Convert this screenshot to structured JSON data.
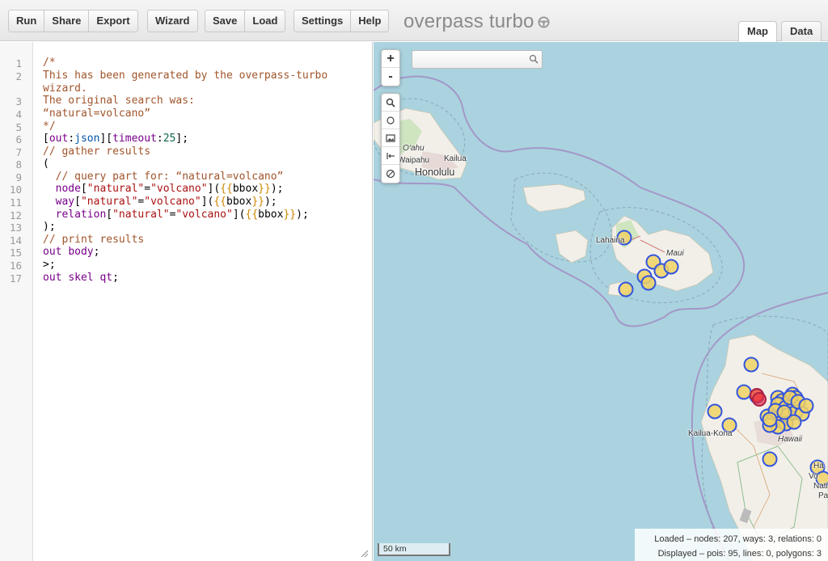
{
  "toolbar": {
    "run": "Run",
    "share": "Share",
    "export": "Export",
    "wizard": "Wizard",
    "save": "Save",
    "load": "Load",
    "settings": "Settings",
    "help": "Help",
    "logo": "overpass turbo"
  },
  "tabs": {
    "map": "Map",
    "data": "Data"
  },
  "editor": {
    "line_numbers": [
      "1",
      "2",
      "",
      "3",
      "4",
      "5",
      "6",
      "7",
      "8",
      "9",
      "10",
      "11",
      "12",
      "13",
      "14",
      "15",
      "16",
      "17"
    ],
    "lines": [
      {
        "parts": [
          {
            "cls": "c",
            "text": "/*"
          }
        ]
      },
      {
        "parts": [
          {
            "cls": "c",
            "text": "This has been generated by the overpass-turbo"
          }
        ]
      },
      {
        "parts": [
          {
            "cls": "c",
            "text": "wizard."
          }
        ]
      },
      {
        "parts": [
          {
            "cls": "c",
            "text": "The original search was:"
          }
        ]
      },
      {
        "parts": [
          {
            "cls": "c",
            "text": "“natural=volcano”"
          }
        ]
      },
      {
        "parts": [
          {
            "cls": "c",
            "text": "*/"
          }
        ]
      },
      {
        "parts": [
          {
            "cls": "",
            "text": "["
          },
          {
            "cls": "k",
            "text": "out"
          },
          {
            "cls": "",
            "text": ":"
          },
          {
            "cls": "t",
            "text": "json"
          },
          {
            "cls": "",
            "text": "]["
          },
          {
            "cls": "k",
            "text": "timeout"
          },
          {
            "cls": "",
            "text": ":"
          },
          {
            "cls": "n",
            "text": "25"
          },
          {
            "cls": "",
            "text": "];"
          }
        ]
      },
      {
        "parts": [
          {
            "cls": "c",
            "text": "// gather results"
          }
        ]
      },
      {
        "parts": [
          {
            "cls": "",
            "text": "("
          }
        ]
      },
      {
        "parts": [
          {
            "cls": "",
            "text": "  "
          },
          {
            "cls": "c",
            "text": "// query part for: “natural=volcano”"
          }
        ]
      },
      {
        "parts": [
          {
            "cls": "",
            "text": "  "
          },
          {
            "cls": "k",
            "text": "node"
          },
          {
            "cls": "",
            "text": "["
          },
          {
            "cls": "s",
            "text": "\"natural\""
          },
          {
            "cls": "",
            "text": "="
          },
          {
            "cls": "s",
            "text": "\"volcano\""
          },
          {
            "cls": "",
            "text": "]("
          },
          {
            "cls": "b",
            "text": "{{"
          },
          {
            "cls": "",
            "text": "bbox"
          },
          {
            "cls": "b",
            "text": "}}"
          },
          {
            "cls": "",
            "text": ");"
          }
        ]
      },
      {
        "parts": [
          {
            "cls": "",
            "text": "  "
          },
          {
            "cls": "k",
            "text": "way"
          },
          {
            "cls": "",
            "text": "["
          },
          {
            "cls": "s",
            "text": "\"natural\""
          },
          {
            "cls": "",
            "text": "="
          },
          {
            "cls": "s",
            "text": "\"volcano\""
          },
          {
            "cls": "",
            "text": "]("
          },
          {
            "cls": "b",
            "text": "{{"
          },
          {
            "cls": "",
            "text": "bbox"
          },
          {
            "cls": "b",
            "text": "}}"
          },
          {
            "cls": "",
            "text": ");"
          }
        ]
      },
      {
        "parts": [
          {
            "cls": "",
            "text": "  "
          },
          {
            "cls": "k",
            "text": "relation"
          },
          {
            "cls": "",
            "text": "["
          },
          {
            "cls": "s",
            "text": "\"natural\""
          },
          {
            "cls": "",
            "text": "="
          },
          {
            "cls": "s",
            "text": "\"volcano\""
          },
          {
            "cls": "",
            "text": "]("
          },
          {
            "cls": "b",
            "text": "{{"
          },
          {
            "cls": "",
            "text": "bbox"
          },
          {
            "cls": "b",
            "text": "}}"
          },
          {
            "cls": "",
            "text": ");"
          }
        ]
      },
      {
        "parts": [
          {
            "cls": "",
            "text": ");"
          }
        ]
      },
      {
        "parts": [
          {
            "cls": "c",
            "text": "// print results"
          }
        ]
      },
      {
        "parts": [
          {
            "cls": "k",
            "text": "out"
          },
          {
            "cls": "",
            "text": " "
          },
          {
            "cls": "k",
            "text": "body"
          },
          {
            "cls": "",
            "text": ";"
          }
        ]
      },
      {
        "parts": [
          {
            "cls": "",
            "text": ">;"
          }
        ]
      },
      {
        "parts": [
          {
            "cls": "k",
            "text": "out"
          },
          {
            "cls": "",
            "text": " "
          },
          {
            "cls": "k",
            "text": "skel"
          },
          {
            "cls": "",
            "text": " "
          },
          {
            "cls": "k",
            "text": "qt"
          },
          {
            "cls": "",
            "text": ";"
          }
        ]
      }
    ]
  },
  "map": {
    "controls": {
      "zoom_in": "+",
      "zoom_out": "-"
    },
    "search": {
      "placeholder": ""
    },
    "labels": {
      "oahu": "O‘ahu",
      "waipahu": "Waipahu",
      "kailua": "Kailua",
      "honolulu": "Honolulu",
      "lahaina": "Lahaina",
      "maui": "Maui",
      "kailua_kona": "Kailua-Kona",
      "hawaii": "Hawaii",
      "cut_1": "Ha",
      "cut_2": "Vo",
      "cut_3": "Nati",
      "cut_4": "Pa"
    },
    "scale": "50 km",
    "stats": {
      "loaded": "Loaded – nodes: 207, ways: 3, relations: 0",
      "displayed": "Displayed – pois: 95, lines: 0, polygons: 3"
    }
  },
  "colors": {
    "sea": "#aad3df",
    "land": "#f2efe9",
    "marker_fill": "#f0d264",
    "marker_stroke": "#3355dd",
    "highlight": "#ee3344"
  }
}
